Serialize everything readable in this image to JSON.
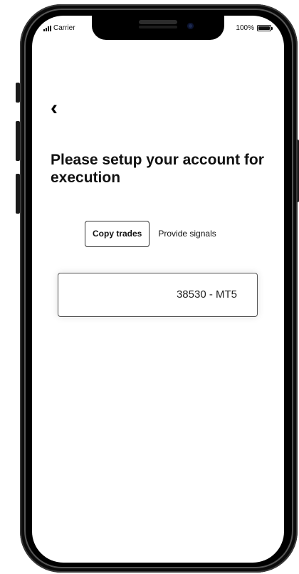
{
  "status_bar": {
    "carrier": "Carrier",
    "battery_percent": "100%",
    "battery_level": 1.0
  },
  "nav": {
    "back_icon": "‹",
    "back_icon_name": "chevron-left-icon"
  },
  "page": {
    "title": "Please setup your account for execution"
  },
  "tabs": [
    {
      "label": "Copy trades",
      "active": true
    },
    {
      "label": "Provide signals",
      "active": false
    }
  ],
  "account": {
    "value": "38530 - MT5"
  },
  "colors": {
    "text": "#111111",
    "border": "#333333",
    "background": "#ffffff",
    "phone_frame": "#000000"
  }
}
